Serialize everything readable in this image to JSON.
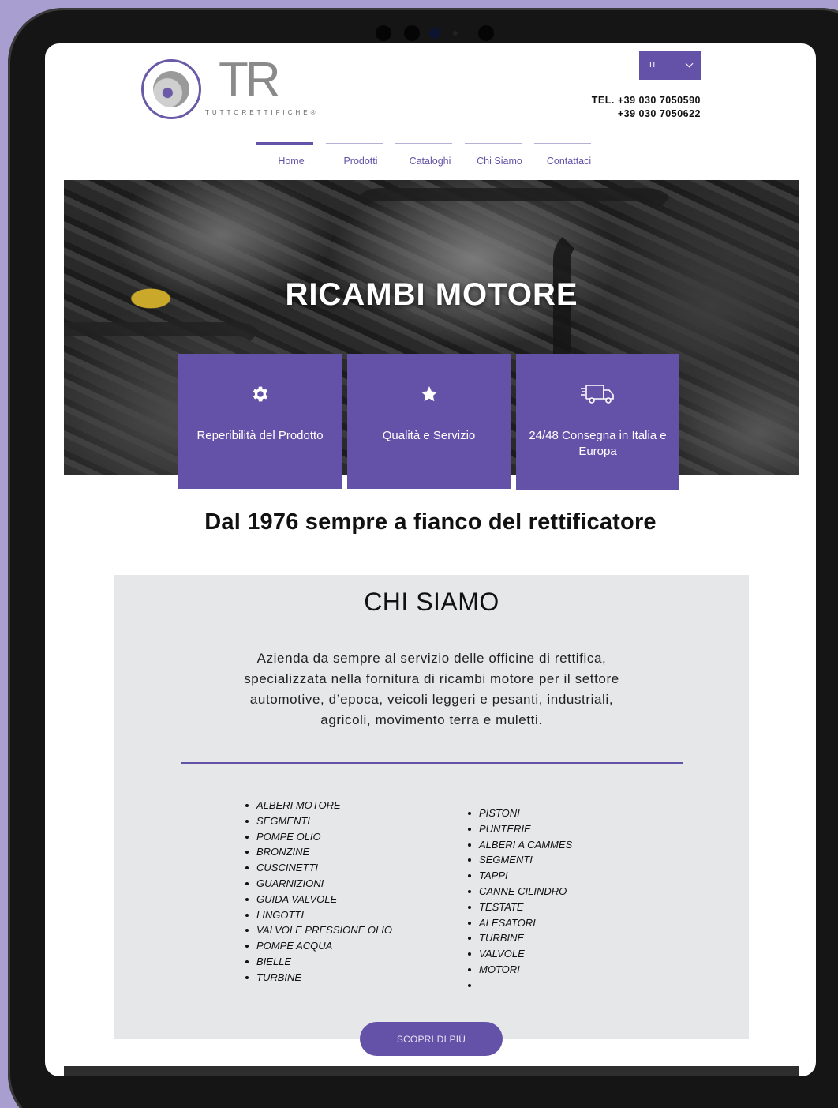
{
  "brand": {
    "logo_letters": "TR",
    "logo_subtitle": "TUTTORETTIFICHE®",
    "colors": {
      "accent": "#6452a8",
      "background": "#a99ed0",
      "panel": "#e6e7e9"
    }
  },
  "header": {
    "language": "IT",
    "phone_line_1": "TEL. +39 030 7050590",
    "phone_line_2": "+39 030 7050622"
  },
  "nav": {
    "items": [
      {
        "label": "Home",
        "active": true
      },
      {
        "label": "Prodotti",
        "active": false
      },
      {
        "label": "Cataloghi",
        "active": false
      },
      {
        "label": "Chi Siamo",
        "active": false
      },
      {
        "label": "Contattaci",
        "active": false
      }
    ]
  },
  "hero": {
    "title": "RICAMBI MOTORE",
    "features": [
      {
        "icon": "gear-icon",
        "label": "Reperibilità del Prodotto"
      },
      {
        "icon": "star-icon",
        "label": "Qualità e Servizio"
      },
      {
        "icon": "truck-icon",
        "label": "24/48 Consegna in Italia e Europa"
      }
    ]
  },
  "tagline": "Dal 1976 sempre a fianco del rettificatore",
  "about": {
    "title": "CHI SIAMO",
    "description": "Azienda da sempre al servizio delle officine di rettifica, specializzata nella fornitura di ricambi motore per il settore automotive, d’epoca, veicoli leggeri e pesanti, industriali, agricoli, movimento terra e muletti.",
    "list_left": [
      "ALBERI MOTORE",
      "SEGMENTI",
      "POMPE OLIO",
      "BRONZINE",
      "CUSCINETTI",
      "GUARNIZIONI",
      "GUIDA VALVOLE",
      "LINGOTTI",
      "VALVOLE PRESSIONE OLIO",
      "POMPE ACQUA",
      "BIELLE",
      "TURBINE"
    ],
    "list_right": [
      "PISTONI",
      "PUNTERIE",
      "ALBERI A CAMMES",
      "SEGMENTI",
      "TAPPI",
      "CANNE CILINDRO",
      "TESTATE",
      "ALESATORI",
      "TURBINE",
      "VALVOLE",
      "MOTORI",
      ""
    ],
    "cta": "SCOPRI DI PIÙ"
  }
}
